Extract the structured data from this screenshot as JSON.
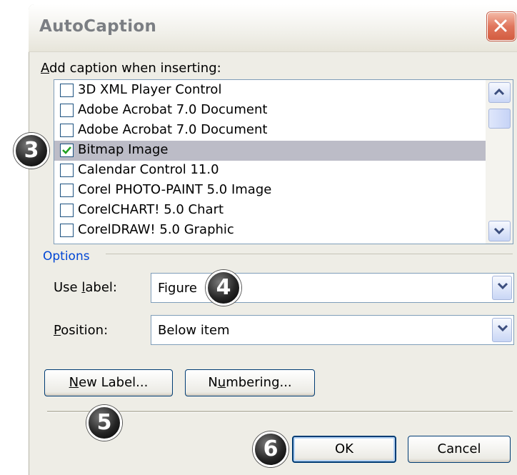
{
  "dialog": {
    "title": "AutoCaption"
  },
  "caption_list": {
    "label_pre": "",
    "label_key": "A",
    "label_post": "dd caption when inserting:",
    "items": [
      {
        "label": "3D XML Player Control",
        "checked": false,
        "selected": false
      },
      {
        "label": "Adobe Acrobat 7.0 Document",
        "checked": false,
        "selected": false
      },
      {
        "label": "Adobe Acrobat 7.0 Document",
        "checked": false,
        "selected": false
      },
      {
        "label": "Bitmap Image",
        "checked": true,
        "selected": true
      },
      {
        "label": "Calendar Control 11.0",
        "checked": false,
        "selected": false
      },
      {
        "label": "Corel PHOTO-PAINT 5.0 Image",
        "checked": false,
        "selected": false
      },
      {
        "label": "CorelCHART! 5.0 Chart",
        "checked": false,
        "selected": false
      },
      {
        "label": "CorelDRAW! 5.0 Graphic",
        "checked": false,
        "selected": false
      }
    ]
  },
  "options": {
    "group_label": "Options",
    "use_label": {
      "pre": "Use ",
      "key": "l",
      "post": "abel:",
      "value": "Figure"
    },
    "position": {
      "pre": "",
      "key": "P",
      "post": "osition:",
      "value": "Below item"
    }
  },
  "buttons": {
    "new_label": {
      "pre": "",
      "key": "N",
      "post": "ew Label..."
    },
    "numbering": {
      "pre": "N",
      "key": "u",
      "post": "mbering..."
    },
    "ok": "OK",
    "cancel": "Cancel"
  },
  "callouts": {
    "c3": "3",
    "c4": "4",
    "c5": "5",
    "c6": "6"
  },
  "colors": {
    "selection": "#bcbcc7",
    "check": "#21a121",
    "close_button": "#d35c40",
    "group_label": "#0046d5"
  },
  "icons": {
    "close": "close-icon",
    "check": "checkmark-icon",
    "up": "chevron-up-icon",
    "down": "chevron-down-icon"
  }
}
